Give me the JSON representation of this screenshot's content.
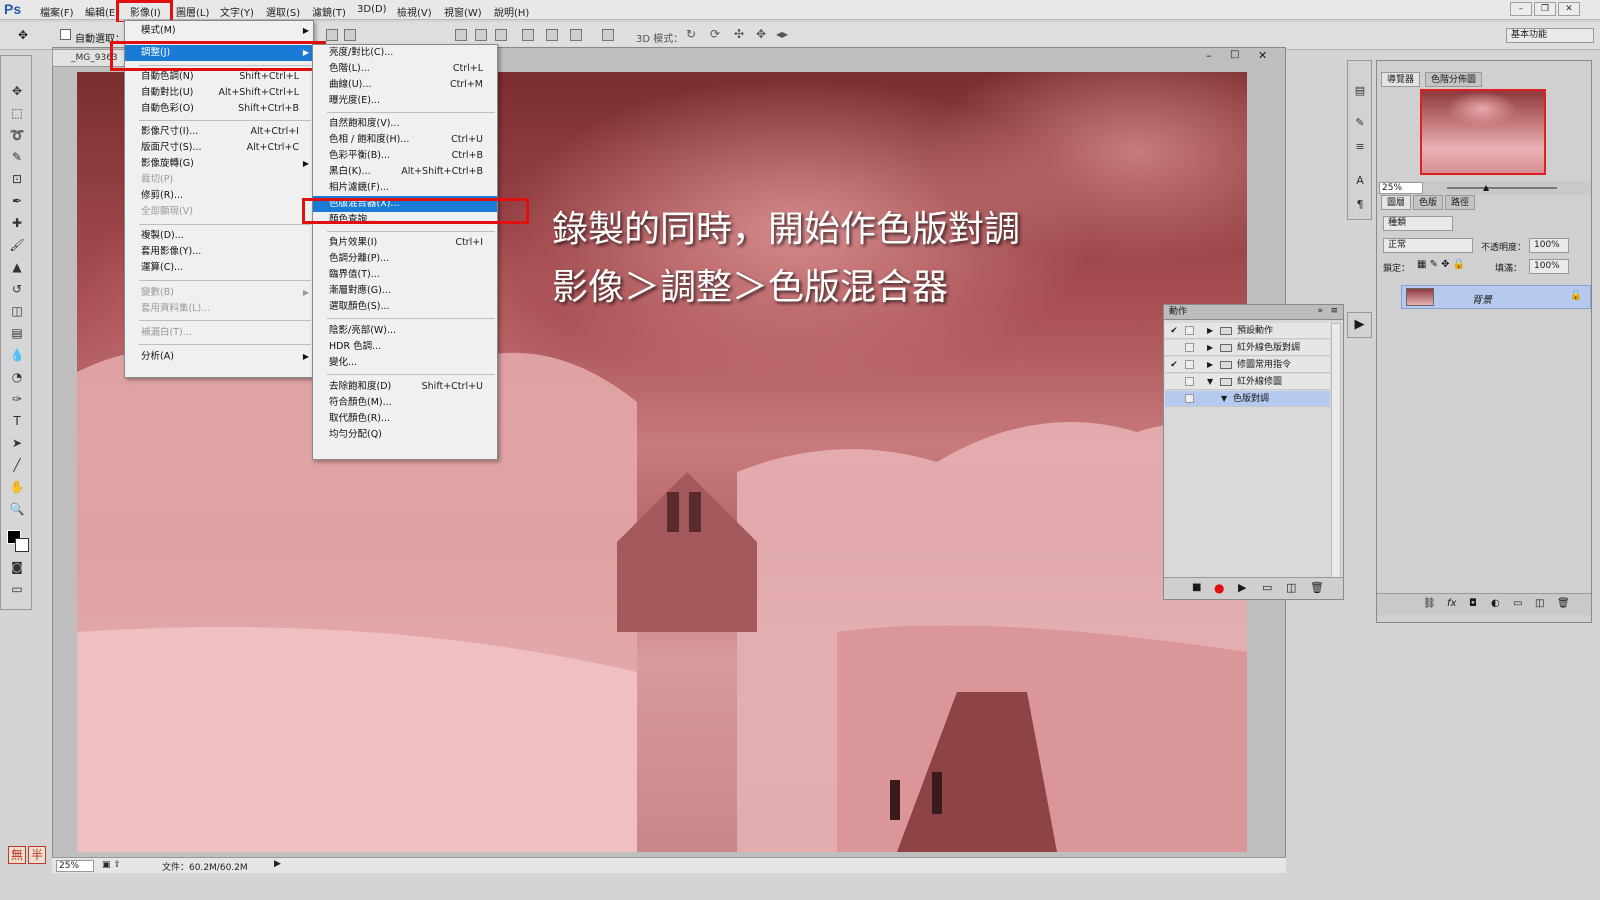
{
  "app": {
    "logo": "Ps",
    "workspace": "基本功能"
  },
  "menubar": [
    "檔案(F)",
    "編輯(E)",
    "影像(I)",
    "圖層(L)",
    "文字(Y)",
    "選取(S)",
    "濾鏡(T)",
    "3D(D)",
    "檢視(V)",
    "視窗(W)",
    "說明(H)"
  ],
  "options": {
    "auto_select": "自動選取：",
    "mode3d": "3D 模式："
  },
  "document": {
    "tab": "_MG_9363",
    "zoom": "25%",
    "file_info": "文件：60.2M/60.2M"
  },
  "image_menu": {
    "items": [
      {
        "label": "模式(M)",
        "shortcut": "",
        "sub": true,
        "dis": false
      },
      {
        "label": "調整(J)",
        "shortcut": "",
        "sub": true,
        "dis": false,
        "hl": true
      },
      {
        "label": "自動色調(N)",
        "shortcut": "Shift+Ctrl+L"
      },
      {
        "label": "自動對比(U)",
        "shortcut": "Alt+Shift+Ctrl+L"
      },
      {
        "label": "自動色彩(O)",
        "shortcut": "Shift+Ctrl+B"
      },
      {
        "label": "影像尺寸(I)...",
        "shortcut": "Alt+Ctrl+I"
      },
      {
        "label": "版面尺寸(S)...",
        "shortcut": "Alt+Ctrl+C"
      },
      {
        "label": "影像旋轉(G)",
        "shortcut": "",
        "sub": true
      },
      {
        "label": "裁切(P)",
        "shortcut": "",
        "dis": true
      },
      {
        "label": "修剪(R)...",
        "shortcut": ""
      },
      {
        "label": "全部顯現(V)",
        "shortcut": "",
        "dis": true
      },
      {
        "label": "複製(D)...",
        "shortcut": ""
      },
      {
        "label": "套用影像(Y)...",
        "shortcut": ""
      },
      {
        "label": "運算(C)...",
        "shortcut": ""
      },
      {
        "label": "變數(B)",
        "shortcut": "",
        "sub": true,
        "dis": true
      },
      {
        "label": "套用資料集(L)...",
        "shortcut": "",
        "dis": true
      },
      {
        "label": "補漏白(T)...",
        "shortcut": "",
        "dis": true
      },
      {
        "label": "分析(A)",
        "shortcut": "",
        "sub": true
      }
    ]
  },
  "adjust_menu": {
    "items": [
      {
        "label": "亮度/對比(C)...",
        "shortcut": ""
      },
      {
        "label": "色階(L)...",
        "shortcut": "Ctrl+L"
      },
      {
        "label": "曲線(U)...",
        "shortcut": "Ctrl+M"
      },
      {
        "label": "曝光度(E)...",
        "shortcut": ""
      },
      {
        "label": "自然飽和度(V)...",
        "shortcut": ""
      },
      {
        "label": "色相 / 飽和度(H)...",
        "shortcut": "Ctrl+U"
      },
      {
        "label": "色彩平衡(B)...",
        "shortcut": "Ctrl+B"
      },
      {
        "label": "黑白(K)...",
        "shortcut": "Alt+Shift+Ctrl+B"
      },
      {
        "label": "相片濾鏡(F)...",
        "shortcut": ""
      },
      {
        "label": "色版混合器(X)...",
        "shortcut": "",
        "hl": true
      },
      {
        "label": "顏色查詢...",
        "shortcut": ""
      },
      {
        "label": "負片效果(I)",
        "shortcut": "Ctrl+I"
      },
      {
        "label": "色調分離(P)...",
        "shortcut": ""
      },
      {
        "label": "臨界值(T)...",
        "shortcut": ""
      },
      {
        "label": "漸層對應(G)...",
        "shortcut": ""
      },
      {
        "label": "選取顏色(S)...",
        "shortcut": ""
      },
      {
        "label": "陰影/亮部(W)...",
        "shortcut": ""
      },
      {
        "label": "HDR 色調...",
        "shortcut": ""
      },
      {
        "label": "變化...",
        "shortcut": ""
      },
      {
        "label": "去除飽和度(D)",
        "shortcut": "Shift+Ctrl+U"
      },
      {
        "label": "符合顏色(M)...",
        "shortcut": ""
      },
      {
        "label": "取代顏色(R)...",
        "shortcut": ""
      },
      {
        "label": "均勻分配(Q)",
        "shortcut": ""
      }
    ]
  },
  "annotation": {
    "line1": "錄製的同時，開始作色版對調",
    "line2": "影像＞調整＞色版混合器"
  },
  "actions_panel": {
    "title": "動作",
    "rows": [
      {
        "check": "✔",
        "label": "預設動作",
        "open": false,
        "level": 0
      },
      {
        "check": "",
        "label": "紅外線色版對調",
        "open": false,
        "level": 0
      },
      {
        "check": "✔",
        "label": "修圖常用指令",
        "open": false,
        "level": 0
      },
      {
        "check": "",
        "label": "紅外線修圖",
        "open": true,
        "level": 0
      },
      {
        "check": "",
        "label": "色版對調",
        "open": true,
        "level": 1,
        "sel": true
      }
    ]
  },
  "right_panels": {
    "nav_tabs": [
      "導覽器",
      "色階分佈圖"
    ],
    "nav_zoom": "25%",
    "layer_tabs": [
      "圖層",
      "色版",
      "路徑"
    ],
    "kind": "種類",
    "blend": "正常",
    "opacity_label": "不透明度：",
    "opacity": "100%",
    "lock_label": "鎖定：",
    "fill_label": "填滿：",
    "fill": "100%",
    "layer_name": "背景"
  },
  "ime": {
    "a": "無",
    "b": "半"
  },
  "colors": {
    "highlight": "#1a7bd6",
    "redbox": "#e01010",
    "selection": "#b6c9ee"
  }
}
